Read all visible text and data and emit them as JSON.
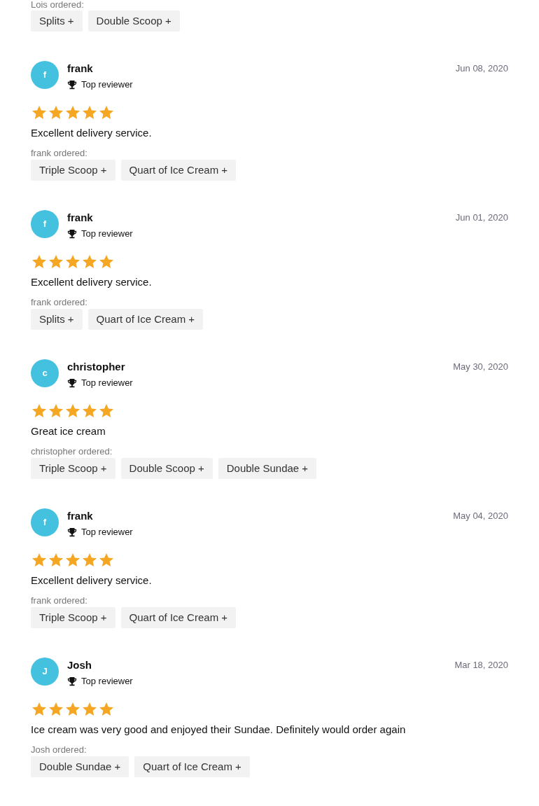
{
  "previous_order": {
    "ordered_label": "Lois ordered:",
    "items": [
      "Splits +",
      "Double Scoop +"
    ]
  },
  "reviews": [
    {
      "initial": "f",
      "color": "#45c1e0",
      "name": "frank",
      "badge": "Top reviewer",
      "date": "Jun 08, 2020",
      "stars": 5,
      "comment": "Excellent delivery service.",
      "ordered_label": "frank ordered:",
      "items": [
        "Triple Scoop +",
        "Quart of Ice Cream +"
      ]
    },
    {
      "initial": "f",
      "color": "#45c1e0",
      "name": "frank",
      "badge": "Top reviewer",
      "date": "Jun 01, 2020",
      "stars": 5,
      "comment": "Excellent delivery service.",
      "ordered_label": "frank ordered:",
      "items": [
        "Splits +",
        "Quart of Ice Cream +"
      ]
    },
    {
      "initial": "c",
      "color": "#45c1e0",
      "name": "christopher",
      "badge": "Top reviewer",
      "date": "May 30, 2020",
      "stars": 5,
      "comment": "Great ice cream",
      "ordered_label": "christopher ordered:",
      "items": [
        "Triple Scoop +",
        "Double Scoop +",
        "Double Sundae +"
      ]
    },
    {
      "initial": "f",
      "color": "#45c1e0",
      "name": "frank",
      "badge": "Top reviewer",
      "date": "May 04, 2020",
      "stars": 5,
      "comment": "Excellent delivery service.",
      "ordered_label": "frank ordered:",
      "items": [
        "Triple Scoop +",
        "Quart of Ice Cream +"
      ]
    },
    {
      "initial": "J",
      "color": "#45c1e0",
      "name": "Josh",
      "badge": "Top reviewer",
      "date": "Mar 18, 2020",
      "stars": 5,
      "comment": "Ice cream was very good and enjoyed their Sundae. Definitely would order again",
      "ordered_label": "Josh ordered:",
      "items": [
        "Double Sundae +",
        "Quart of Ice Cream +"
      ]
    }
  ]
}
